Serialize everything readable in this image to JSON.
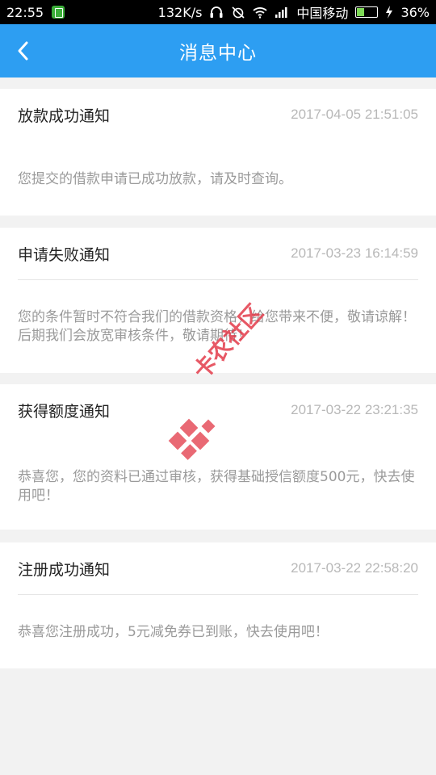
{
  "status_bar": {
    "time": "22:55",
    "network_speed": "132K/s",
    "carrier": "中国移动",
    "battery": "36%",
    "battery_level": 0.36,
    "icons": [
      "app-notification-icon",
      "headphones-icon",
      "alarm-off-icon",
      "wifi-icon",
      "signal-icon",
      "battery-icon",
      "charging-icon"
    ]
  },
  "nav": {
    "title": "消息中心",
    "back_icon": "chevron-left-icon"
  },
  "messages": [
    {
      "title": "放款成功通知",
      "time": "2017-04-05 21:51:05",
      "body": "您提交的借款申请已成功放款，请及时查询。"
    },
    {
      "title": "申请失败通知",
      "time": "2017-03-23 16:14:59",
      "body": "您的条件暂时不符合我们的借款资格，给您带来不便，敬请谅解！后期我们会放宽审核条件，敬请期待！"
    },
    {
      "title": "获得额度通知",
      "time": "2017-03-22 23:21:35",
      "body": "恭喜您，您的资料已通过审核，获得基础授信额度500元，快去使用吧！"
    },
    {
      "title": "注册成功通知",
      "time": "2017-03-22 22:58:20",
      "body": "恭喜您注册成功，5元减免券已到账，快去使用吧！"
    }
  ],
  "watermark": {
    "text": "卡农社区",
    "colors": {
      "primary": "#e33c4b"
    }
  },
  "colors": {
    "nav_bg": "#2d9ef2",
    "page_bg": "#f2f2f2",
    "time_text": "#b8b8b8",
    "body_text": "#9a9a9a"
  }
}
